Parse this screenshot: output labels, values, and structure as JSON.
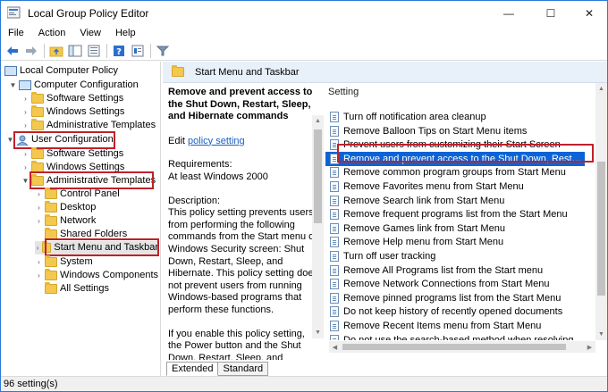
{
  "window": {
    "title": "Local Group Policy Editor"
  },
  "controls": {
    "minimize": "—",
    "maximize": "☐",
    "close": "✕"
  },
  "menu": [
    "File",
    "Action",
    "View",
    "Help"
  ],
  "tree": {
    "root": "Local Computer Policy",
    "computer_config": "Computer Configuration",
    "cc_children": [
      "Software Settings",
      "Windows Settings",
      "Administrative Templates"
    ],
    "user_config": "User Configuration",
    "uc_children": [
      "Software Settings",
      "Windows Settings"
    ],
    "admin_templates": "Administrative Templates",
    "at_children": [
      "Control Panel",
      "Desktop",
      "Network",
      "Shared Folders"
    ],
    "start_menu": "Start Menu and Taskbar",
    "at_children_after": [
      "System",
      "Windows Components",
      "All Settings"
    ]
  },
  "right_pane": {
    "header": "Start Menu and Taskbar",
    "policy_title": "Remove and prevent access to the Shut Down, Restart, Sleep, and Hibernate commands",
    "edit_prefix": "Edit",
    "edit_link": "policy setting",
    "requirements_label": "Requirements:",
    "requirements_value": "At least Windows 2000",
    "description_label": "Description:",
    "description_text": "This policy setting prevents users from performing the following commands from the Start menu or Windows Security screen: Shut Down, Restart, Sleep, and Hibernate. This policy setting does not prevent users from running Windows-based programs that perform these functions.",
    "description_text2": "If you enable this policy setting, the Power button and the Shut Down, Restart, Sleep, and Hibernate commands are",
    "column_header": "Setting",
    "settings": [
      "Turn off notification area cleanup",
      "Remove Balloon Tips on Start Menu items",
      "Prevent users from customizing their Start Screen",
      "Remove and prevent access to the Shut Down, Restart, Sleep...",
      "Remove common program groups from Start Menu",
      "Remove Favorites menu from Start Menu",
      "Remove Search link from Start Menu",
      "Remove frequent programs list from the Start Menu",
      "Remove Games link from Start Menu",
      "Remove Help menu from Start Menu",
      "Turn off user tracking",
      "Remove All Programs list from the Start menu",
      "Remove Network Connections from Start Menu",
      "Remove pinned programs list from the Start Menu",
      "Do not keep history of recently opened documents",
      "Remove Recent Items menu from Start Menu",
      "Do not use the search-based method when resolving shell s..."
    ],
    "selected_index": 3,
    "tabs": [
      "Extended",
      "Standard"
    ]
  },
  "status": {
    "text": "96 setting(s)"
  },
  "colors": {
    "selection": "#0a64d6",
    "highlight_box": "#c0202a",
    "header_bg": "#e8f0fa"
  }
}
